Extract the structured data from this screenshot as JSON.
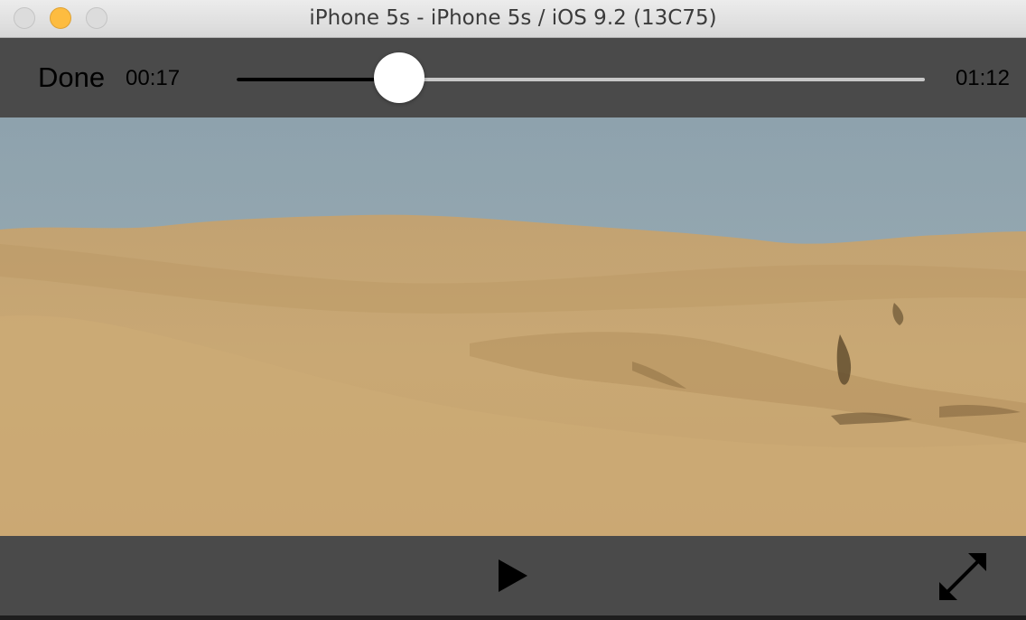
{
  "window": {
    "title": "iPhone 5s - iPhone 5s / iOS 9.2 (13C75)",
    "controls": [
      "close-button",
      "minimize-button",
      "zoom-button"
    ]
  },
  "player": {
    "done_label": "Done",
    "elapsed": "00:17",
    "duration": "01:12",
    "progress_fraction": 0.236,
    "play_icon": "play-icon",
    "fullscreen_icon": "fullscreen-icon"
  },
  "colors": {
    "bar_background": "#4a4a4a",
    "minimize_light": "#fdbc40"
  }
}
